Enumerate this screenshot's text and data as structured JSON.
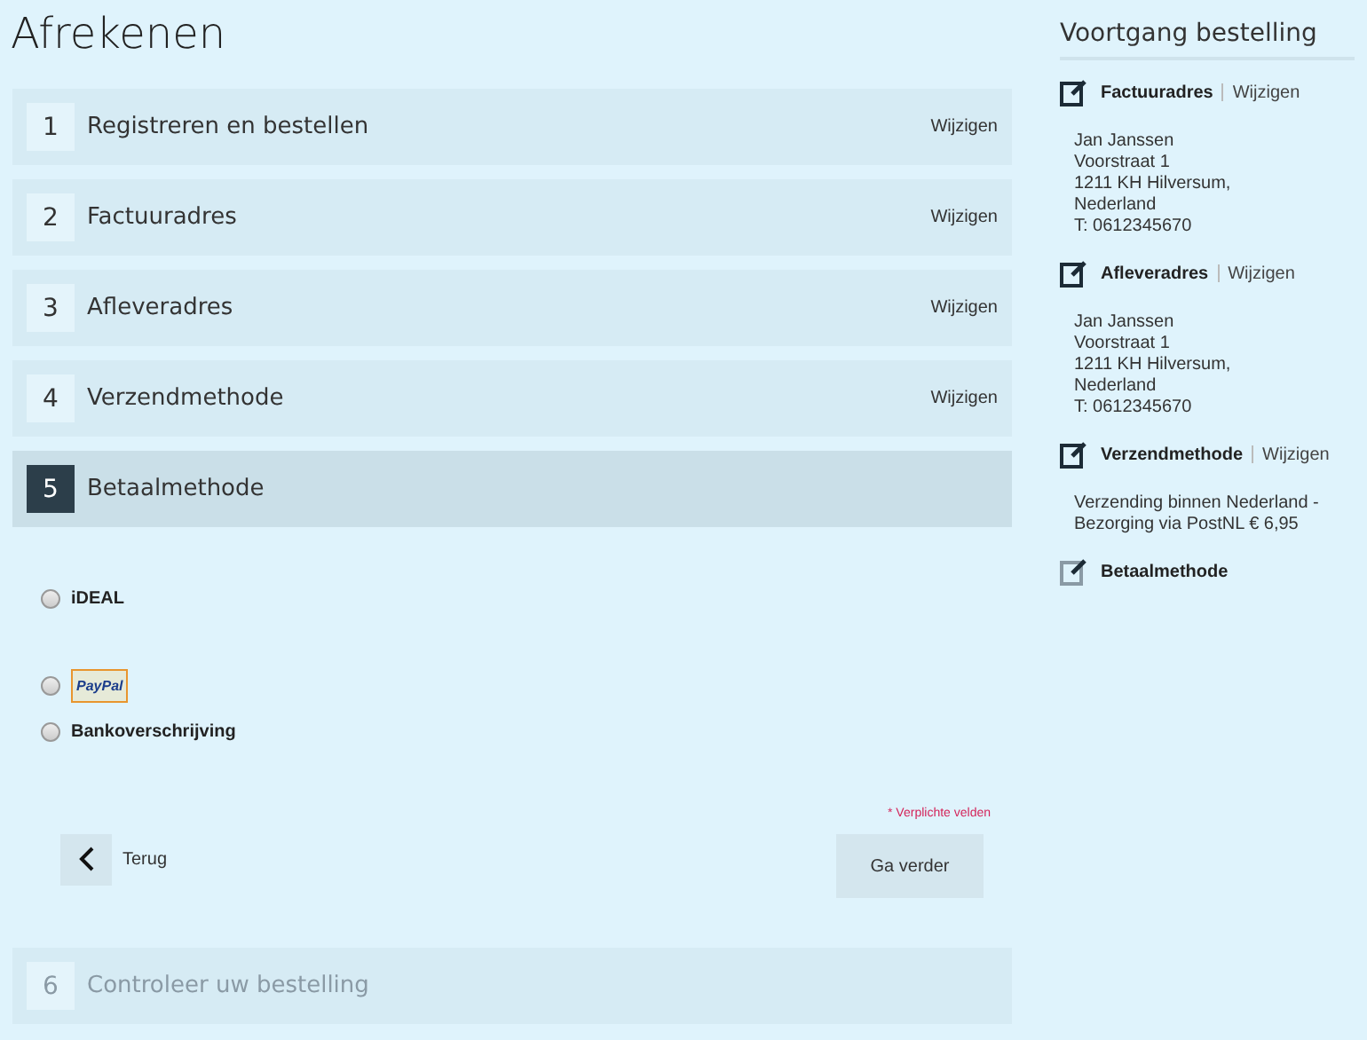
{
  "title": "Afrekenen",
  "steps": [
    {
      "number": "1",
      "label": "Registreren en bestellen",
      "selected": false,
      "disabled": false,
      "action": "Wijzigen"
    },
    {
      "number": "2",
      "label": "Factuuradres",
      "selected": false,
      "disabled": false,
      "action": "Wijzigen"
    },
    {
      "number": "3",
      "label": "Afleveradres",
      "selected": false,
      "disabled": false,
      "action": "Wijzigen"
    },
    {
      "number": "4",
      "label": "Verzendmethode",
      "selected": false,
      "disabled": false,
      "action": "Wijzigen"
    },
    {
      "number": "5",
      "label": "Betaalmethode",
      "selected": true,
      "disabled": false
    },
    {
      "number": "6",
      "label": "Controleer uw bestelling",
      "selected": false,
      "disabled": true
    }
  ],
  "payment_options": [
    {
      "kind": "text",
      "label": "iDEAL",
      "selected": false
    },
    {
      "kind": "logo",
      "label": "PayPal",
      "selected": false
    },
    {
      "kind": "text",
      "label": "Bankoverschrijving",
      "selected": false
    }
  ],
  "required_note": "* Verplichte velden",
  "back_button": "Terug",
  "next_button": "Ga verder",
  "sidebar": {
    "title": "Voortgang bestelling",
    "sections": [
      {
        "title": "Factuuradres",
        "completed": true,
        "action": "Wijzigen",
        "lines": [
          "Jan Janssen",
          "Voorstraat 1",
          "1211 KH Hilversum,",
          "Nederland",
          "T: 0612345670"
        ]
      },
      {
        "title": "Afleveradres",
        "completed": true,
        "action": "Wijzigen",
        "lines": [
          "Jan Janssen",
          "Voorstraat 1",
          "1211 KH Hilversum,",
          "Nederland",
          "T: 0612345670"
        ]
      },
      {
        "title": "Verzendmethode",
        "completed": true,
        "action": "Wijzigen",
        "lines": [
          "Verzending binnen Nederland -",
          "Bezorging via PostNL € 6,95"
        ]
      },
      {
        "title": "Betaalmethode",
        "completed": false
      }
    ]
  }
}
